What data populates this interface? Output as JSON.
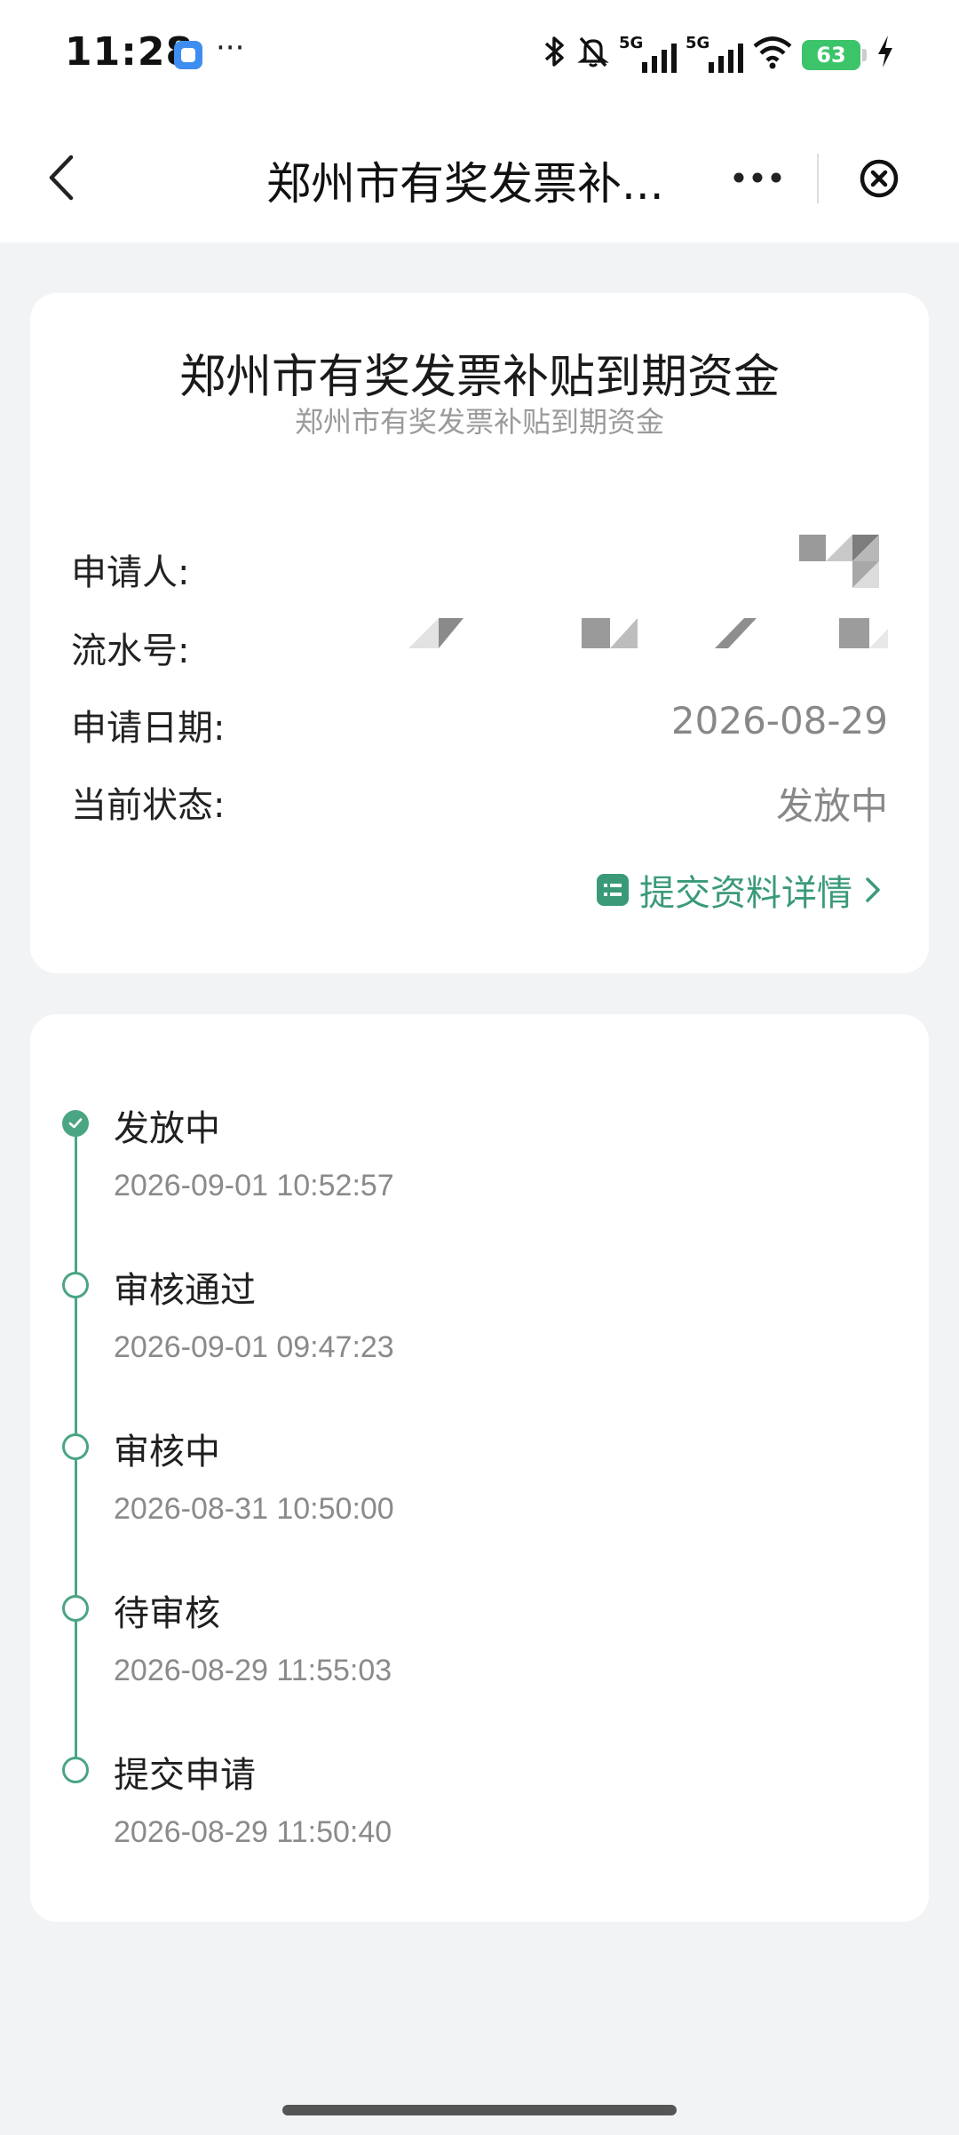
{
  "status_bar": {
    "time": "11:28",
    "more": "···",
    "network1": "5G",
    "network2": "5G",
    "battery": "63",
    "icons": [
      "bluetooth-icon",
      "mute-bell-icon",
      "signal-icon",
      "signal-icon",
      "wifi-icon",
      "battery-icon",
      "charging-icon"
    ]
  },
  "nav": {
    "title": "郑州市有奖发票补..."
  },
  "info_card": {
    "title": "郑州市有奖发票补贴到期资金",
    "subtitle": "郑州市有奖发票补贴到期资金",
    "rows": [
      {
        "label": "申请人:",
        "value": ""
      },
      {
        "label": "流水号:",
        "value": ""
      },
      {
        "label": "申请日期:",
        "value": "2026-08-29"
      },
      {
        "label": "当前状态:",
        "value": "发放中"
      }
    ],
    "details_link": "提交资料详情"
  },
  "timeline": [
    {
      "status": "发放中",
      "time": "2026-09-01 10:52:57",
      "done": true
    },
    {
      "status": "审核通过",
      "time": "2026-09-01 09:47:23",
      "done": false
    },
    {
      "status": "审核中",
      "time": "2026-08-31 10:50:00",
      "done": false
    },
    {
      "status": "待审核",
      "time": "2026-08-29 11:55:03",
      "done": false
    },
    {
      "status": "提交申请",
      "time": "2026-08-29 11:50:40",
      "done": false
    }
  ],
  "colors": {
    "accent": "#4aa583",
    "link": "#3a9a78",
    "background": "#f2f3f5"
  }
}
